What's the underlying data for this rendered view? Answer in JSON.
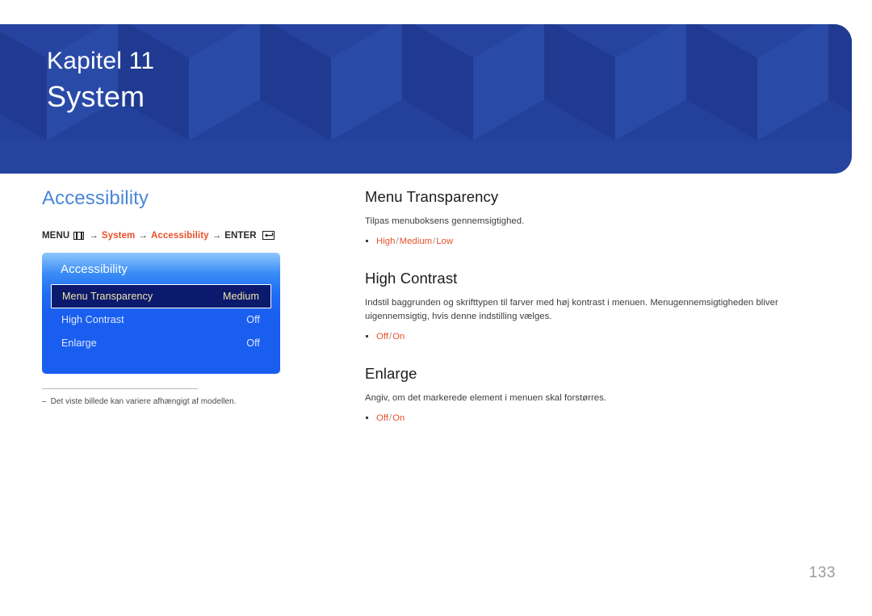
{
  "header": {
    "kicker": "Kapitel 11",
    "title": "System",
    "background_color": "#23409a",
    "pattern": "isometric-cubes"
  },
  "left": {
    "section_heading": "Accessibility",
    "heading_color": "#4a87d8",
    "menu_path": {
      "menu_label": "MENU",
      "menu_icon": "menu-bars-icon",
      "arrow": "→",
      "link1": "System",
      "link2": "Accessibility",
      "enter_label": "ENTER",
      "enter_icon": "enter-return-icon",
      "link_color": "#e8502a"
    },
    "osd": {
      "title": "Accessibility",
      "rows": [
        {
          "label": "Menu Transparency",
          "value": "Medium",
          "selected": true
        },
        {
          "label": "High Contrast",
          "value": "Off",
          "selected": false
        },
        {
          "label": "Enlarge",
          "value": "Off",
          "selected": false
        }
      ],
      "selected_bg": "#0c1a6e",
      "selected_text": "#f2e6a8",
      "panel_color": "#1a5ef0"
    },
    "footnote": {
      "dash": "‒",
      "text": "Det viste billede kan variere afhængigt af modellen."
    }
  },
  "right": {
    "topics": [
      {
        "title": "Menu Transparency",
        "description": "Tilpas menuboksens gennemsigtighed.",
        "options": [
          "High",
          "Medium",
          "Low"
        ]
      },
      {
        "title": "High Contrast",
        "description": "Indstil baggrunden og skrifttypen til farver med høj kontrast i menuen. Menugennemsigtigheden bliver uigennemsigtig, hvis denne indstilling vælges.",
        "options": [
          "Off",
          "On"
        ]
      },
      {
        "title": "Enlarge",
        "description": "Angiv, om det markerede element i menuen skal forstørres.",
        "options": [
          "Off",
          "On"
        ]
      }
    ],
    "option_separator": "/",
    "option_color": "#e8502a"
  },
  "footer": {
    "page_number": "133"
  }
}
